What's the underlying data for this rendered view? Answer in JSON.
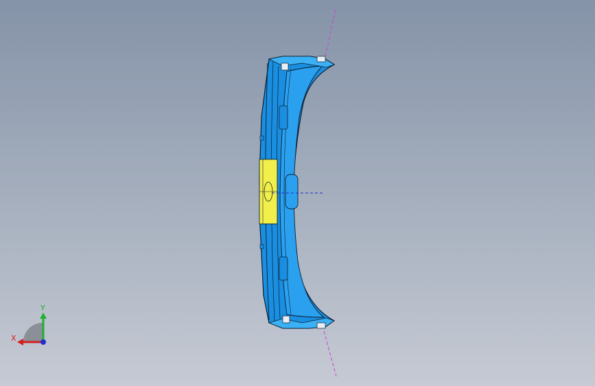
{
  "viewport": {
    "background_top": "#8593a8",
    "background_bottom": "#c6cad4"
  },
  "model": {
    "body_color": "#1a8ee0",
    "edge_color": "#0b1e30",
    "highlight_color": "#f3ef4a",
    "center_axis_color": "#2030d0",
    "construction_line_color": "#d040d0"
  },
  "triad": {
    "x_label": "X",
    "y_label": "Y",
    "x_color": "#d22020",
    "y_color": "#22b030",
    "z_color": "#2030d0"
  }
}
